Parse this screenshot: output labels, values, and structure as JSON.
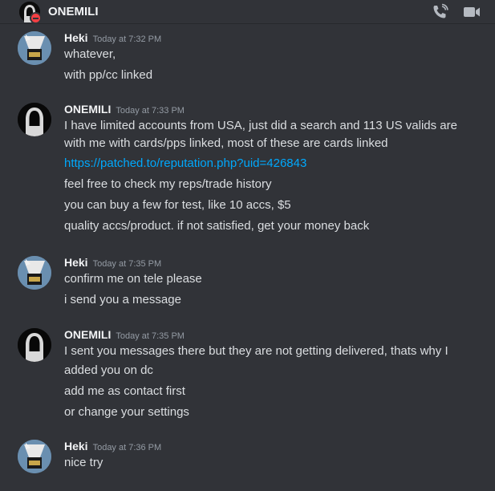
{
  "header": {
    "title": "ONEMILI",
    "icons": [
      "phone-call-icon",
      "video-call-icon"
    ]
  },
  "messages": [
    {
      "author": "Heki",
      "timestamp": "Today at 7:32 PM",
      "lines": [
        "whatever,",
        "with pp/cc linked"
      ]
    },
    {
      "author": "ONEMILI",
      "timestamp": "Today at 7:33 PM",
      "lines": [
        "I have limited accounts from USA, just did a search and 113 US valids are",
        "with me with cards/pps linked, most of these are cards linked",
        "https://patched.to/reputation.php?uid=426843",
        "feel free to check my reps/trade history",
        "you can buy a few for test, like 10 accs, $5",
        "quality accs/product. if not satisfied, get your money back"
      ]
    },
    {
      "author": "Heki",
      "timestamp": "Today at 7:35 PM",
      "lines": [
        "confirm me on tele please",
        "i send you a message"
      ]
    },
    {
      "author": "ONEMILI",
      "timestamp": "Today at 7:35 PM",
      "lines": [
        "I sent you messages there but they are not getting delivered, thats why I",
        "added you on dc",
        "add me as contact first",
        "or change your settings"
      ]
    },
    {
      "author": "Heki",
      "timestamp": "Today at 7:36 PM",
      "lines": [
        "nice try"
      ]
    }
  ],
  "colors": {
    "background": "#313338",
    "link": "#00a8fc",
    "dnd_status": "#f23f43"
  }
}
